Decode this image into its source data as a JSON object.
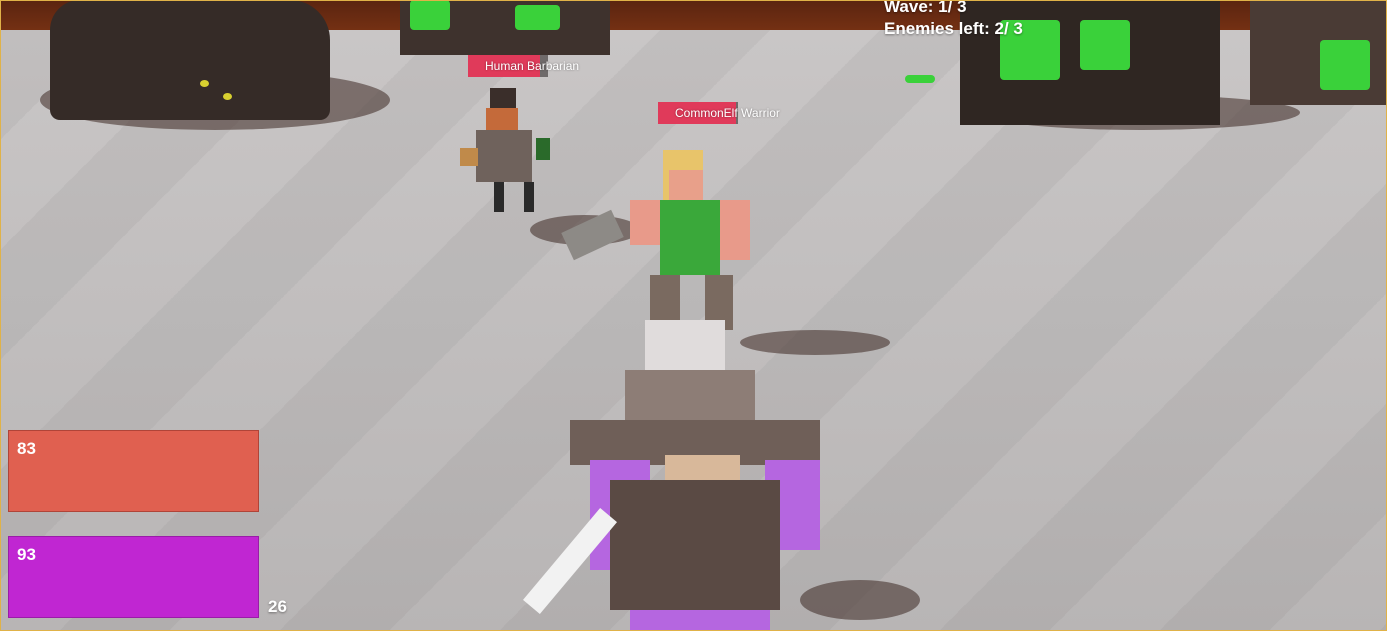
{
  "hud": {
    "wave_text": "Wave: 1/ 3",
    "enemies_text": "Enemies left: 2/ 3",
    "health_value": "83",
    "mana_value": "93",
    "ammo_value": "26"
  },
  "enemies": [
    {
      "name": "Human Barbarian",
      "health_fraction": 0.9
    },
    {
      "name": "CommonElf Warrior",
      "health_fraction": 0.97
    }
  ],
  "colors": {
    "health": "#e06050",
    "mana": "#c026d2",
    "enemy_health": "#e03a5a"
  }
}
